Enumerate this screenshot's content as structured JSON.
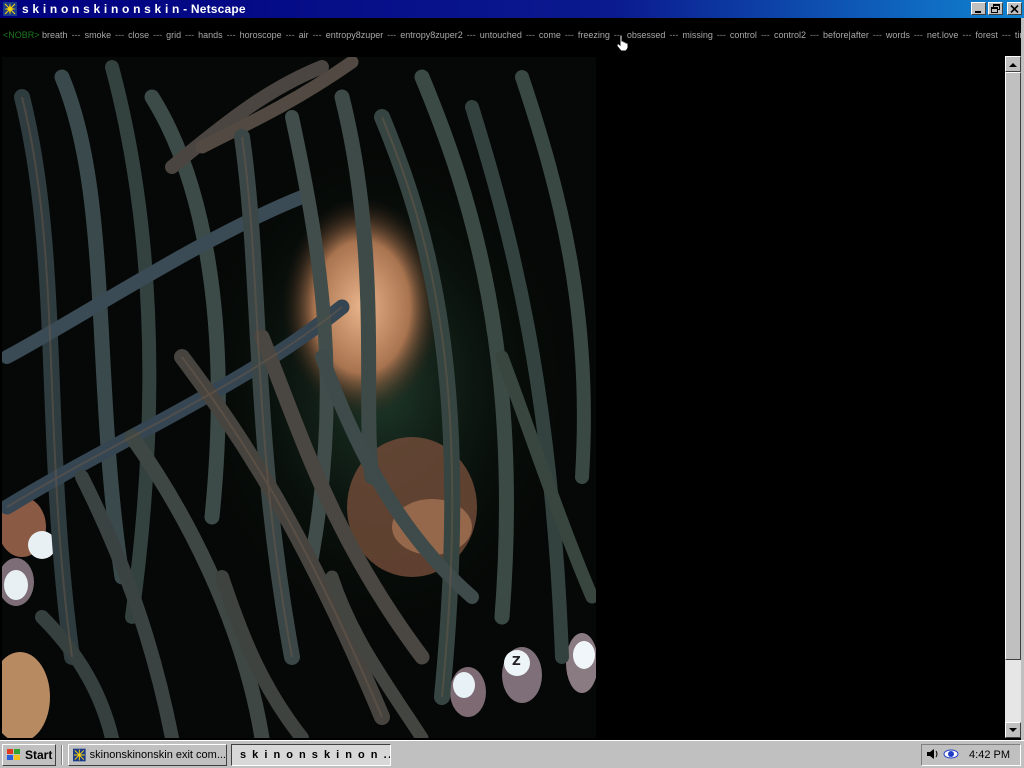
{
  "window": {
    "title": "s k i n o n s k i n o n s k i n - Netscape",
    "icon": "netscape-icon",
    "controls": [
      "minimize-icon",
      "restore-icon",
      "close-icon"
    ]
  },
  "nav": {
    "prefix": "<NOBR>",
    "separator": "---",
    "links": [
      "breath",
      "smoke",
      "close",
      "grid",
      "hands",
      "horoscope",
      "air",
      "entropy8zuper",
      "entropy8zuper2",
      "untouched",
      "come",
      "freezing",
      "obsessed",
      "missing",
      "control",
      "control2",
      "before|after",
      "words",
      "net.love",
      "forest",
      "time"
    ]
  },
  "photo": {
    "description_icon": "photo-dreadlocks",
    "letter": "Z"
  },
  "taskbar": {
    "start_label": "Start",
    "tasks": [
      {
        "label": "skinonskinonskin exit com...",
        "active": false
      },
      {
        "label": "s k i n o n s k i n o n ...",
        "active": true
      }
    ],
    "clock": "4:42 PM"
  },
  "colors": {
    "title_bar": "#000080",
    "page_bg": "#000000",
    "chrome": "#c0c0c0"
  }
}
